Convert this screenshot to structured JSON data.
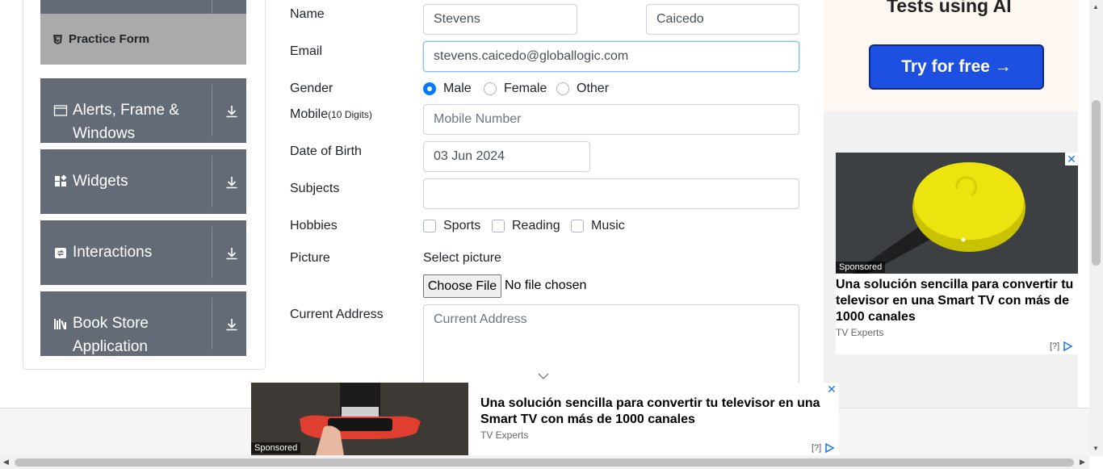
{
  "sidebar": {
    "active_item": "Practice Form",
    "groups": [
      {
        "label": "Alerts, Frame & Windows",
        "icon": "window-icon"
      },
      {
        "label": "Widgets",
        "icon": "widgets-icon"
      },
      {
        "label": "Interactions",
        "icon": "interactions-icon"
      },
      {
        "label": "Book Store Application",
        "icon": "book-icon"
      }
    ]
  },
  "form": {
    "name_label": "Name",
    "first_name": "Stevens",
    "last_name": "Caicedo",
    "email_label": "Email",
    "email": "stevens.caicedo@globallogic.com",
    "gender_label": "Gender",
    "gender_options": [
      "Male",
      "Female",
      "Other"
    ],
    "gender_selected": "Male",
    "mobile_label": "Mobile",
    "mobile_hint": "(10 Digits)",
    "mobile_placeholder": "Mobile Number",
    "dob_label": "Date of Birth",
    "dob": "03 Jun 2024",
    "subjects_label": "Subjects",
    "subjects_value": "",
    "hobbies_label": "Hobbies",
    "hobbies": [
      "Sports",
      "Reading",
      "Music"
    ],
    "picture_label": "Picture",
    "select_picture": "Select picture",
    "choose_file": "Choose File",
    "no_file": "No file chosen",
    "address_label": "Current Address",
    "address_placeholder": "Current Address"
  },
  "ads": {
    "top_heading": "Tests using AI",
    "try_button": "Try for free →",
    "card": {
      "sponsored": "Sponsored",
      "title": "Una solución sencilla para convertir tu televisor en una Smart TV con más de 1000 canales",
      "source": "TV Experts",
      "adchoice": "[?]"
    },
    "bottom": {
      "sponsored": "Sponsored",
      "title": "Una solución sencilla para convertir tu televisor en una Smart TV con más de 1000 canales",
      "source": "TV Experts",
      "adchoice": "[?]"
    }
  },
  "colors": {
    "sidebar_group": "#636c76",
    "active_item": "#aaaaaa",
    "accent": "#007bff",
    "try_button": "#1d4fe0"
  }
}
